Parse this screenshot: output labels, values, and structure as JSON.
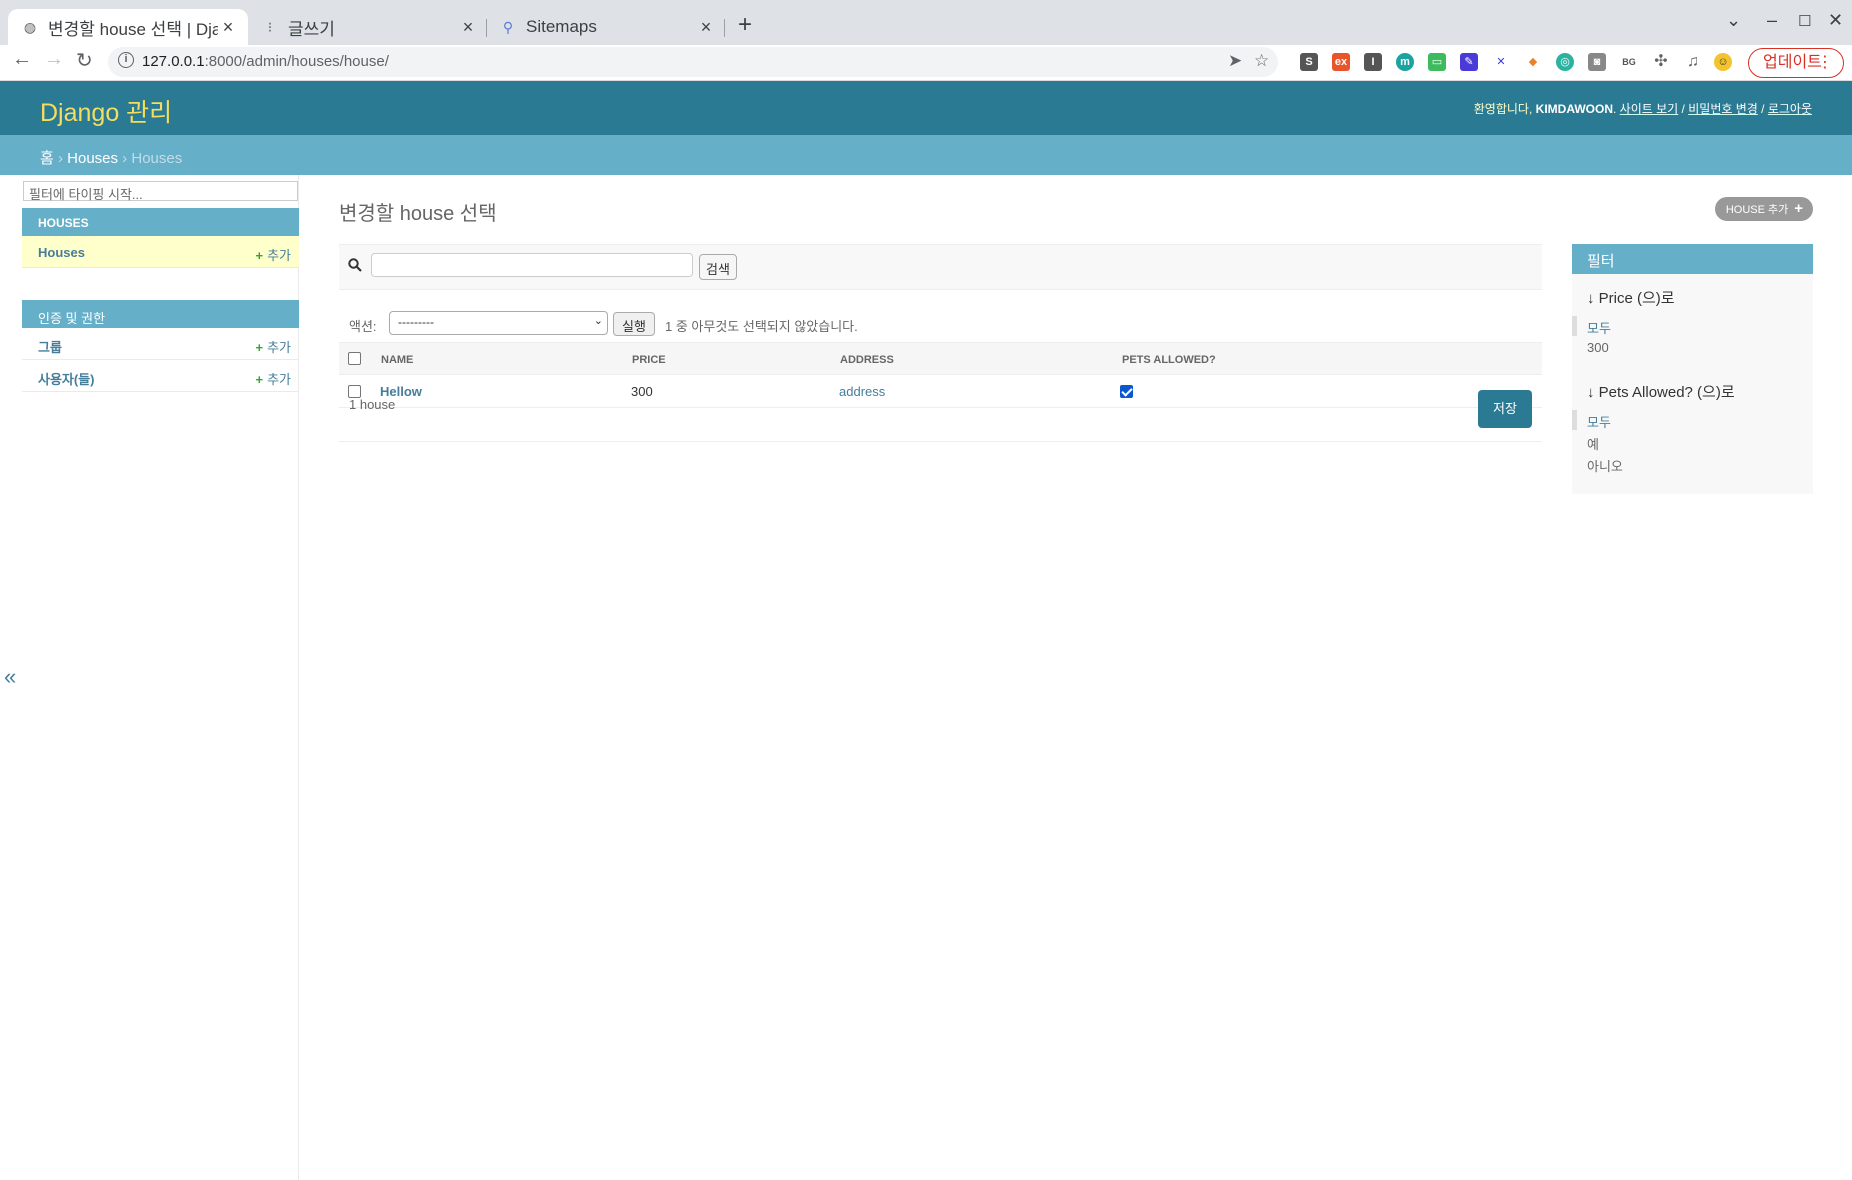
{
  "browser": {
    "tabs": [
      {
        "label": "변경할 house 선택 | Djang",
        "favicon": "globe-icon",
        "active": true
      },
      {
        "label": "글쓰기",
        "favicon": "dots-icon",
        "active": false
      },
      {
        "label": "Sitemaps",
        "favicon": "sitemap-icon",
        "active": false
      }
    ],
    "url_host": "127.0.0.1",
    "url_path": ":8000/admin/houses/house/",
    "update_label": "업데이트"
  },
  "header": {
    "brand": "Django 관리",
    "welcome": "환영합니다,",
    "username": "KIMDAWOON",
    "view_site": "사이트 보기",
    "change_password": "비밀번호 변경",
    "logout": "로그아웃"
  },
  "breadcrumbs": {
    "home": "홈",
    "app": "Houses",
    "current": "Houses"
  },
  "sidebar": {
    "filter_placeholder": "필터에 타이핑 시작...",
    "modules": [
      {
        "caption": "Houses",
        "items": [
          {
            "label": "Houses",
            "add": "추가",
            "current": true
          }
        ]
      },
      {
        "caption": "인증 및 권한",
        "items": [
          {
            "label": "그룹",
            "add": "추가",
            "current": false
          },
          {
            "label": "사용자(들)",
            "add": "추가",
            "current": false
          }
        ]
      }
    ],
    "collapse_label": "«"
  },
  "content": {
    "title": "변경할 house 선택",
    "add_button": "House 추가",
    "search_button": "검색",
    "search_value": "",
    "actions_label": "액션:",
    "actions_selected": "---------",
    "actions_go": "실행",
    "selection_counter": "1 중 아무것도 선택되지 않았습니다.",
    "columns": [
      "Name",
      "Price",
      "Address",
      "Pets allowed?"
    ],
    "rows": [
      {
        "name": "Hellow",
        "price": "300",
        "address": "address",
        "pets_allowed": true
      }
    ],
    "result_count": "1 house",
    "save_button": "저장"
  },
  "filters": {
    "caption": "필터",
    "groups": [
      {
        "title": "↓ Price (으)로",
        "items": [
          "모두",
          "300"
        ],
        "selected": 0
      },
      {
        "title": "↓ Pets Allowed? (으)로",
        "items": [
          "모두",
          "예",
          "아니오"
        ],
        "selected": 0
      }
    ]
  },
  "colors": {
    "header_bg": "#2b7a93",
    "breadcrumb_bg": "#65afc9",
    "brand_yellow": "#f5dd5d",
    "link_blue": "#447e9b",
    "add_green": "#2bab2b",
    "current_row": "#ffffcc"
  }
}
